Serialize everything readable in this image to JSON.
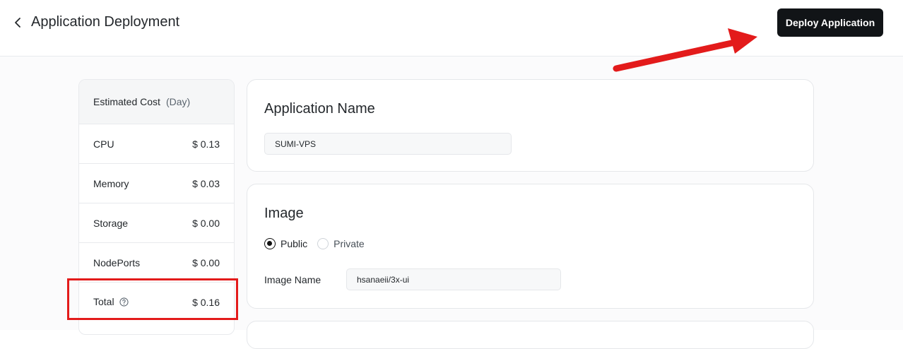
{
  "header": {
    "title": "Application Deployment",
    "deploy_label": "Deploy Application"
  },
  "cost": {
    "title": "Estimated Cost",
    "unit": "(Day)",
    "rows": [
      {
        "label": "CPU",
        "value": "$ 0.13"
      },
      {
        "label": "Memory",
        "value": "$ 0.03"
      },
      {
        "label": "Storage",
        "value": "$ 0.00"
      },
      {
        "label": "NodePorts",
        "value": "$ 0.00"
      },
      {
        "label": "Total",
        "value": "$ 0.16"
      }
    ]
  },
  "app_name": {
    "title": "Application Name",
    "value": "SUMI-VPS"
  },
  "image": {
    "title": "Image",
    "options": [
      "Public",
      "Private"
    ],
    "selected": "Public",
    "name_label": "Image Name",
    "name_value": "hsanaeii/3x-ui"
  },
  "annotations": {
    "arrow_color": "#e31b1b",
    "highlight_color": "#e31b1b"
  }
}
